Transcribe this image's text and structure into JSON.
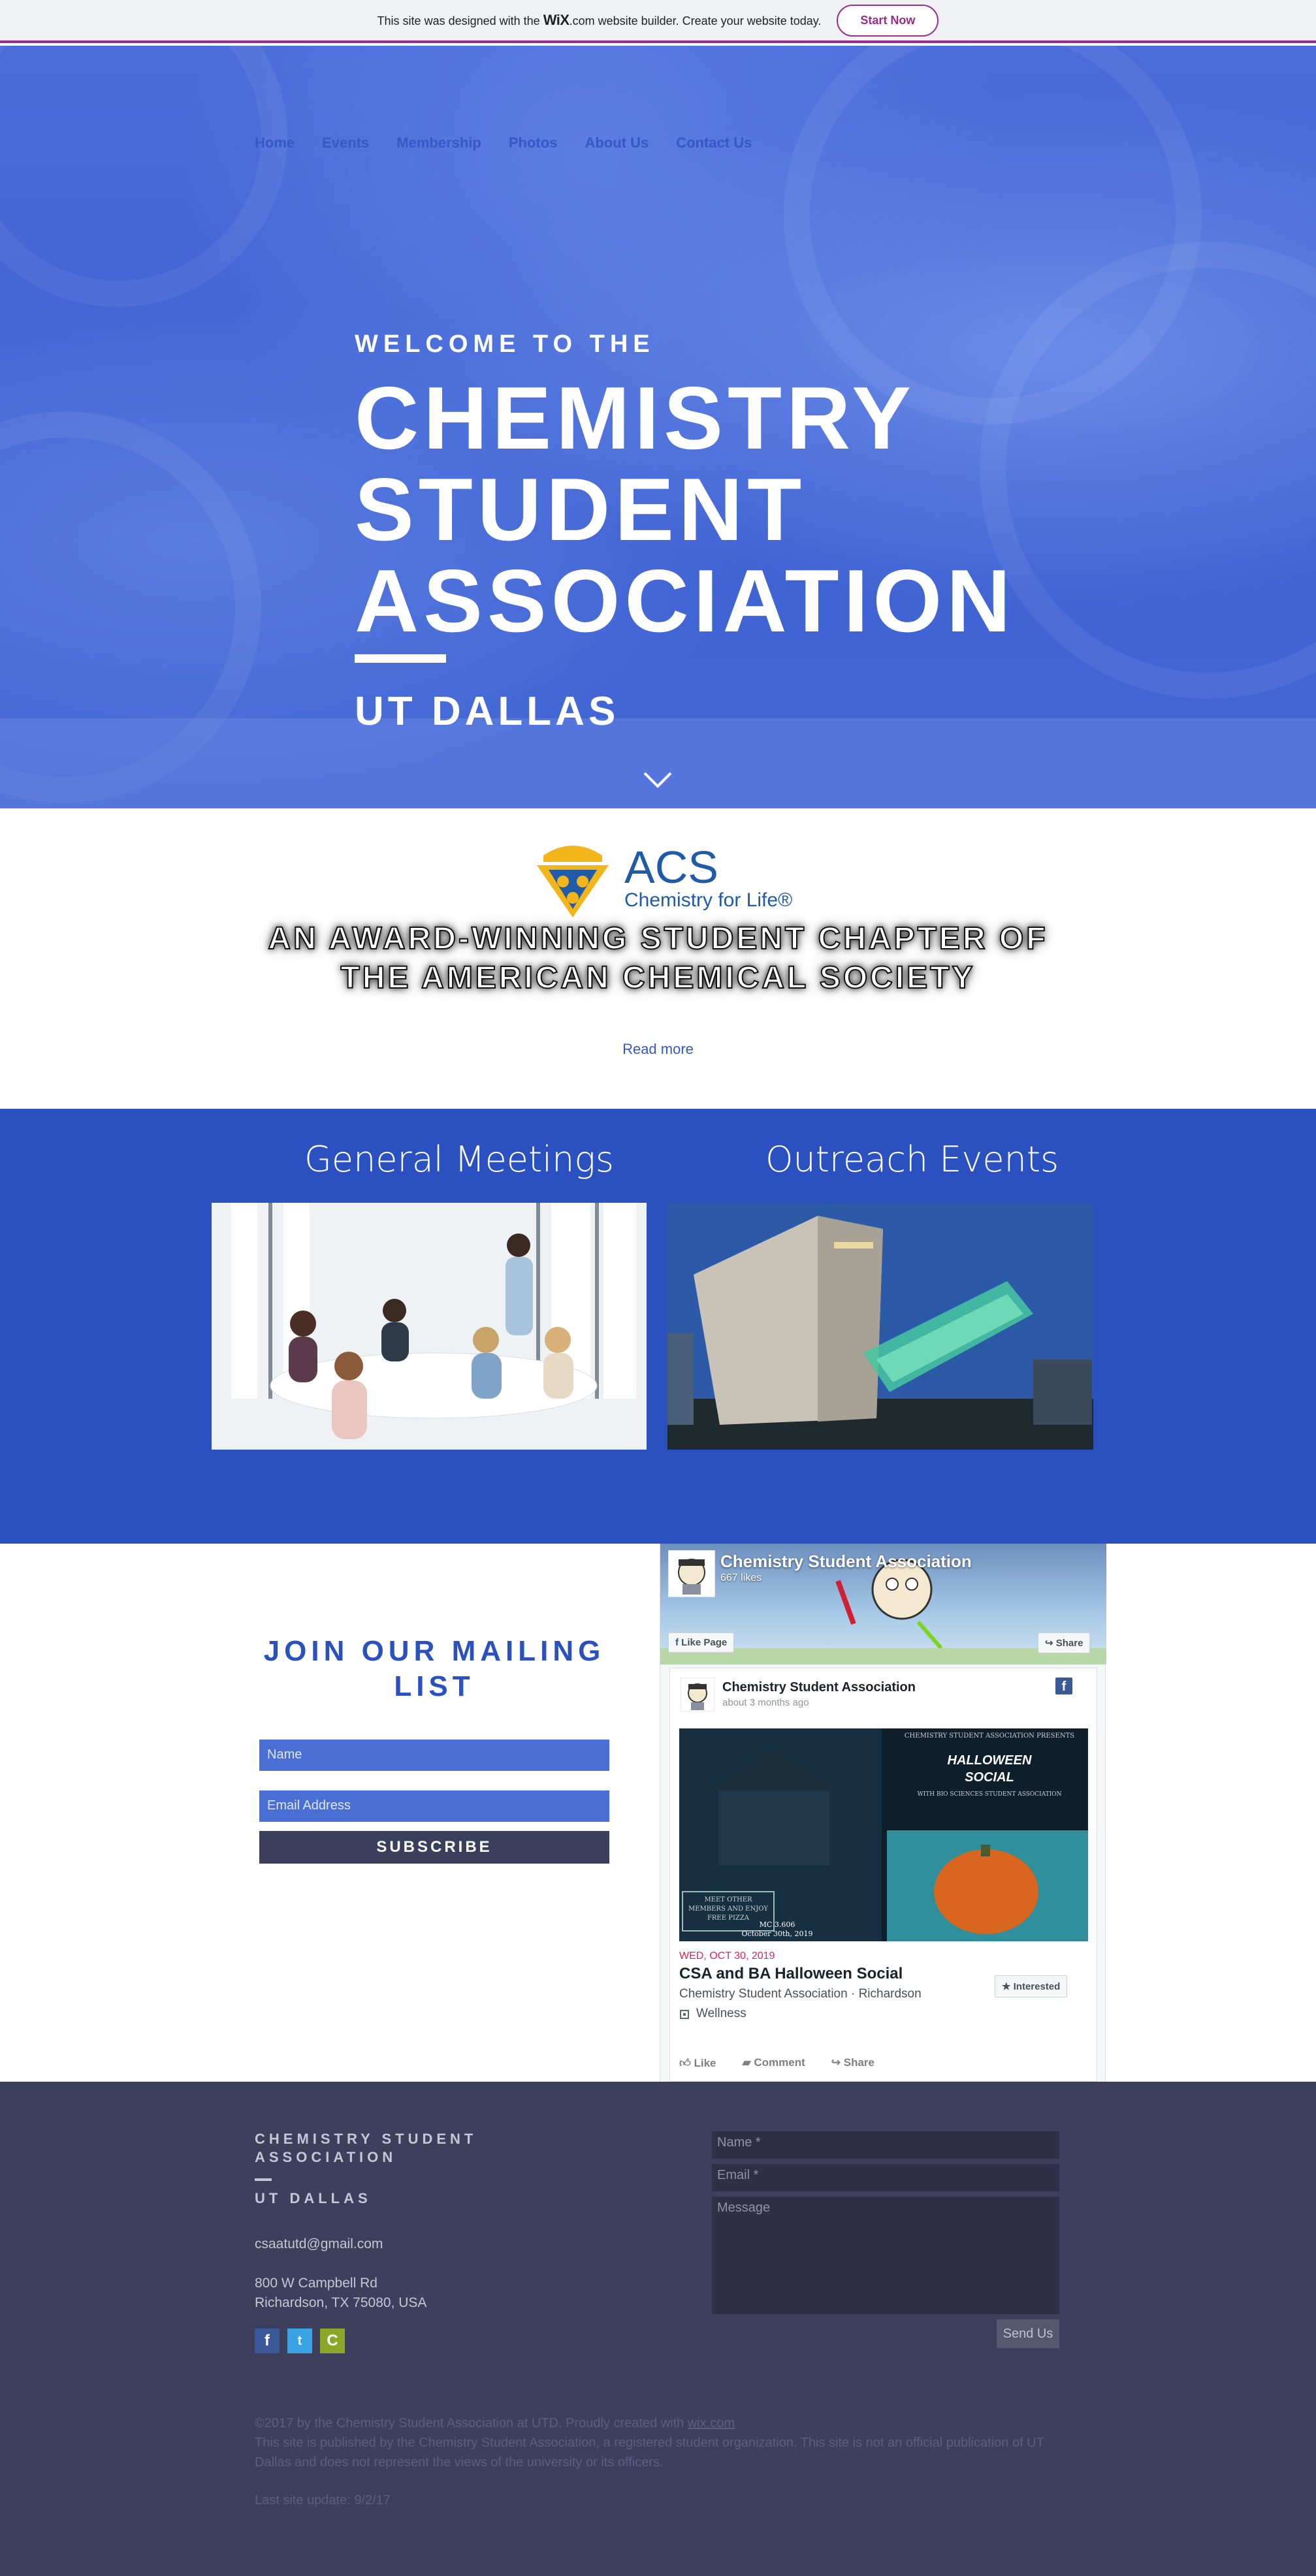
{
  "wix_banner": {
    "message_before": "This site was designed with the",
    "brand": "WiX",
    "message_after": ".com website builder. Create your website today.",
    "button": "Start Now"
  },
  "nav": {
    "items": [
      "Home",
      "Events",
      "Membership",
      "Photos",
      "About Us",
      "Contact Us"
    ]
  },
  "hero": {
    "welcome": "WELCOME TO THE",
    "title_line1": "CHEMISTRY",
    "title_line2": "STUDENT",
    "title_line3": "ASSOCIATION",
    "subtitle": "UT DALLAS"
  },
  "acs": {
    "logo_text": "ACS",
    "logo_tagline": "Chemistry for Life®",
    "headline_line1": "AN AWARD-WINNING STUDENT CHAPTER OF",
    "headline_line2": "THE AMERICAN CHEMICAL SOCIETY",
    "read_more": "Read more"
  },
  "features": [
    {
      "title": "General Meetings"
    },
    {
      "title": "Outreach Events"
    }
  ],
  "mailing": {
    "title": "JOIN OUR MAILING LIST",
    "name_placeholder": "Name",
    "email_placeholder": "Email Address",
    "subscribe": "SUBSCRIBE"
  },
  "facebook": {
    "page_name": "Chemistry Student Association",
    "likes": "667 likes",
    "like_page": "Like Page",
    "share": "Share",
    "post_author": "Chemistry Student Association",
    "post_time": "about 3 months ago",
    "event_date": "WED, OCT 30, 2019",
    "event_title": "CSA and BA Halloween Social",
    "event_host": "Chemistry Student Association · Richardson",
    "event_category": "Wellness",
    "interested": "Interested",
    "action_like": "Like",
    "action_comment": "Comment",
    "action_share": "Share",
    "flyer_line1": "CHEMISTRY STUDENT ASSOCIATION PRESENTS",
    "flyer_title": "HALLOWEEN SOCIAL",
    "flyer_line2": "WITH BIO SCIENCES STUDENT ASSOCIATION",
    "flyer_meet": "MEET OTHER MEMBERS AND ENJOY FREE PIZZA",
    "flyer_place": "MC 3.606",
    "flyer_date": "October 30th, 2019"
  },
  "footer": {
    "org_line1": "CHEMISTRY STUDENT",
    "org_line2": "ASSOCIATION",
    "org_utd": "UT DALLAS",
    "email": "csaatutd@gmail.com",
    "address_line1": "800 W Campbell Rd",
    "address_line2": "Richardson, TX 75080, USA",
    "form_name": "Name *",
    "form_email": "Email *",
    "form_message": "Message",
    "send": "Send Us",
    "copyright": "©2017 by the Chemistry Student Association at UTD. Proudly created with",
    "copyright_link": "wix.com",
    "disclaimer": "This site is published by the Chemistry Student Association, a registered student organization. This site is not an official publication of UT Dallas and does not represent the views of the university or its officers.",
    "last_update": "Last site update: 9/2/17"
  },
  "colors": {
    "primary_blue": "#2b50c0",
    "footer_bg": "#3d3f5c",
    "wix_accent": "#9a2b8f"
  }
}
